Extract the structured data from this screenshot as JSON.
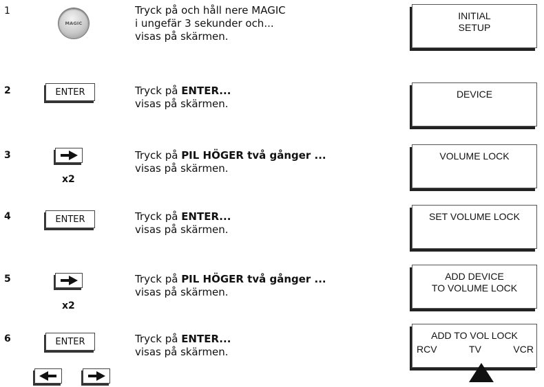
{
  "steps": [
    {
      "number": "1",
      "line1": "Tryck på och håll nere MAGIC",
      "line2": "i ungefär 3 sekunder och...",
      "line3": "visas på skärmen.",
      "button": "MAGIC",
      "screen": [
        "INITIAL",
        "SETUP"
      ]
    },
    {
      "number": "2",
      "line1_prefix": "Tryck på ",
      "line1_bold": "ENTER...",
      "line2": "visas på skärmen.",
      "button": "ENTER",
      "screen": [
        "DEVICE"
      ]
    },
    {
      "number": "3",
      "line1_prefix": "Tryck på ",
      "line1_bold": "PIL HÖGER två gånger ...",
      "line2": "visas på skärmen.",
      "repeat": "x2",
      "screen": [
        "VOLUME LOCK"
      ]
    },
    {
      "number": "4",
      "line1_prefix": "Tryck på ",
      "line1_bold": "ENTER...",
      "line2": "visas på skärmen.",
      "button": "ENTER",
      "screen": [
        "SET VOLUME LOCK"
      ]
    },
    {
      "number": "5",
      "line1_prefix": "Tryck på ",
      "line1_bold": "PIL HÖGER två gånger ...",
      "line2": "visas på skärmen.",
      "repeat": "x2",
      "screen": [
        "ADD DEVICE",
        "TO VOLUME LOCK"
      ]
    },
    {
      "number": "6",
      "line1_prefix": "Tryck på ",
      "line1_bold": "ENTER...",
      "line2": "visas på skärmen.",
      "button": "ENTER",
      "screen_title": "ADD TO VOL LOCK",
      "options": [
        "RCV",
        "TV",
        "VCR"
      ]
    }
  ]
}
